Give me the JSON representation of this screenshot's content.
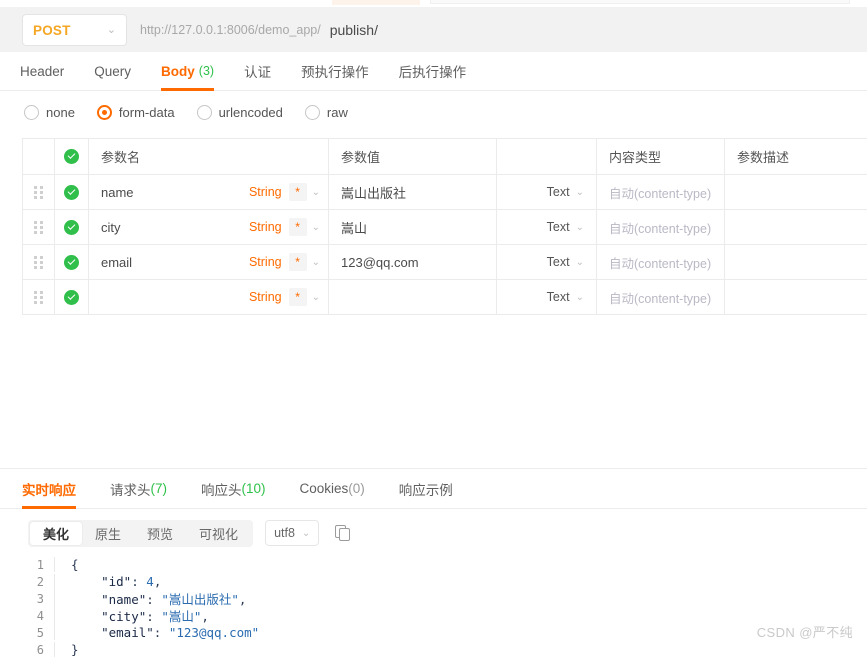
{
  "request": {
    "method": "POST",
    "method_caret": "chevron-down",
    "url_prefix": "http://127.0.0.1:8006/demo_app/",
    "url_path": "publish/",
    "tabs": [
      {
        "label": "Header",
        "count": "",
        "active": false
      },
      {
        "label": "Query",
        "count": "",
        "active": false
      },
      {
        "label": "Body",
        "count": "(3)",
        "active": true
      },
      {
        "label": "认证",
        "count": "",
        "active": false
      },
      {
        "label": "预执行操作",
        "count": "",
        "active": false
      },
      {
        "label": "后执行操作",
        "count": "",
        "active": false
      }
    ],
    "body_types": [
      {
        "label": "none",
        "selected": false
      },
      {
        "label": "form-data",
        "selected": true
      },
      {
        "label": "urlencoded",
        "selected": false
      },
      {
        "label": "raw",
        "selected": false
      }
    ],
    "table": {
      "headers": {
        "name": "参数名",
        "value": "参数值",
        "content_type": "内容类型",
        "description": "参数描述"
      },
      "rows": [
        {
          "enabled": true,
          "name": "name",
          "type": "String",
          "required": "*",
          "value": "嵩山出版社",
          "value_type": "Text",
          "content_type": "自动(content-type)",
          "description": ""
        },
        {
          "enabled": true,
          "name": "city",
          "type": "String",
          "required": "*",
          "value": "嵩山",
          "value_type": "Text",
          "content_type": "自动(content-type)",
          "description": ""
        },
        {
          "enabled": true,
          "name": "email",
          "type": "String",
          "required": "*",
          "value": "123@qq.com",
          "value_type": "Text",
          "content_type": "自动(content-type)",
          "description": ""
        },
        {
          "enabled": true,
          "name": "",
          "type": "String",
          "required": "*",
          "value": "",
          "value_type": "Text",
          "content_type": "自动(content-type)",
          "description": ""
        }
      ]
    }
  },
  "response": {
    "tabs": [
      {
        "label": "实时响应",
        "count": "",
        "active": true
      },
      {
        "label": "请求头",
        "count": "(7)",
        "active": false
      },
      {
        "label": "响应头",
        "count": "(10)",
        "active": false
      },
      {
        "label": "Cookies",
        "count": "(0)",
        "active": false
      },
      {
        "label": "响应示例",
        "count": "",
        "active": false
      }
    ],
    "view_modes": [
      {
        "label": "美化",
        "active": true
      },
      {
        "label": "原生",
        "active": false
      },
      {
        "label": "预览",
        "active": false
      },
      {
        "label": "可视化",
        "active": false
      }
    ],
    "encoding": "utf8",
    "copy_icon": "copy-icon",
    "code_lines": [
      {
        "no": "1",
        "text": "{"
      },
      {
        "no": "2",
        "text": "    \"id\": 4,"
      },
      {
        "no": "3",
        "text": "    \"name\": \"嵩山出版社\","
      },
      {
        "no": "4",
        "text": "    \"city\": \"嵩山\","
      },
      {
        "no": "5",
        "text": "    \"email\": \"123@qq.com\""
      },
      {
        "no": "6",
        "text": "}"
      }
    ]
  },
  "watermark": "CSDN @严不纯",
  "colors": {
    "accent": "#ff6a00",
    "method": "#f5a623",
    "ok_green": "#2fbf4a",
    "count_green": "#2ec14a"
  }
}
